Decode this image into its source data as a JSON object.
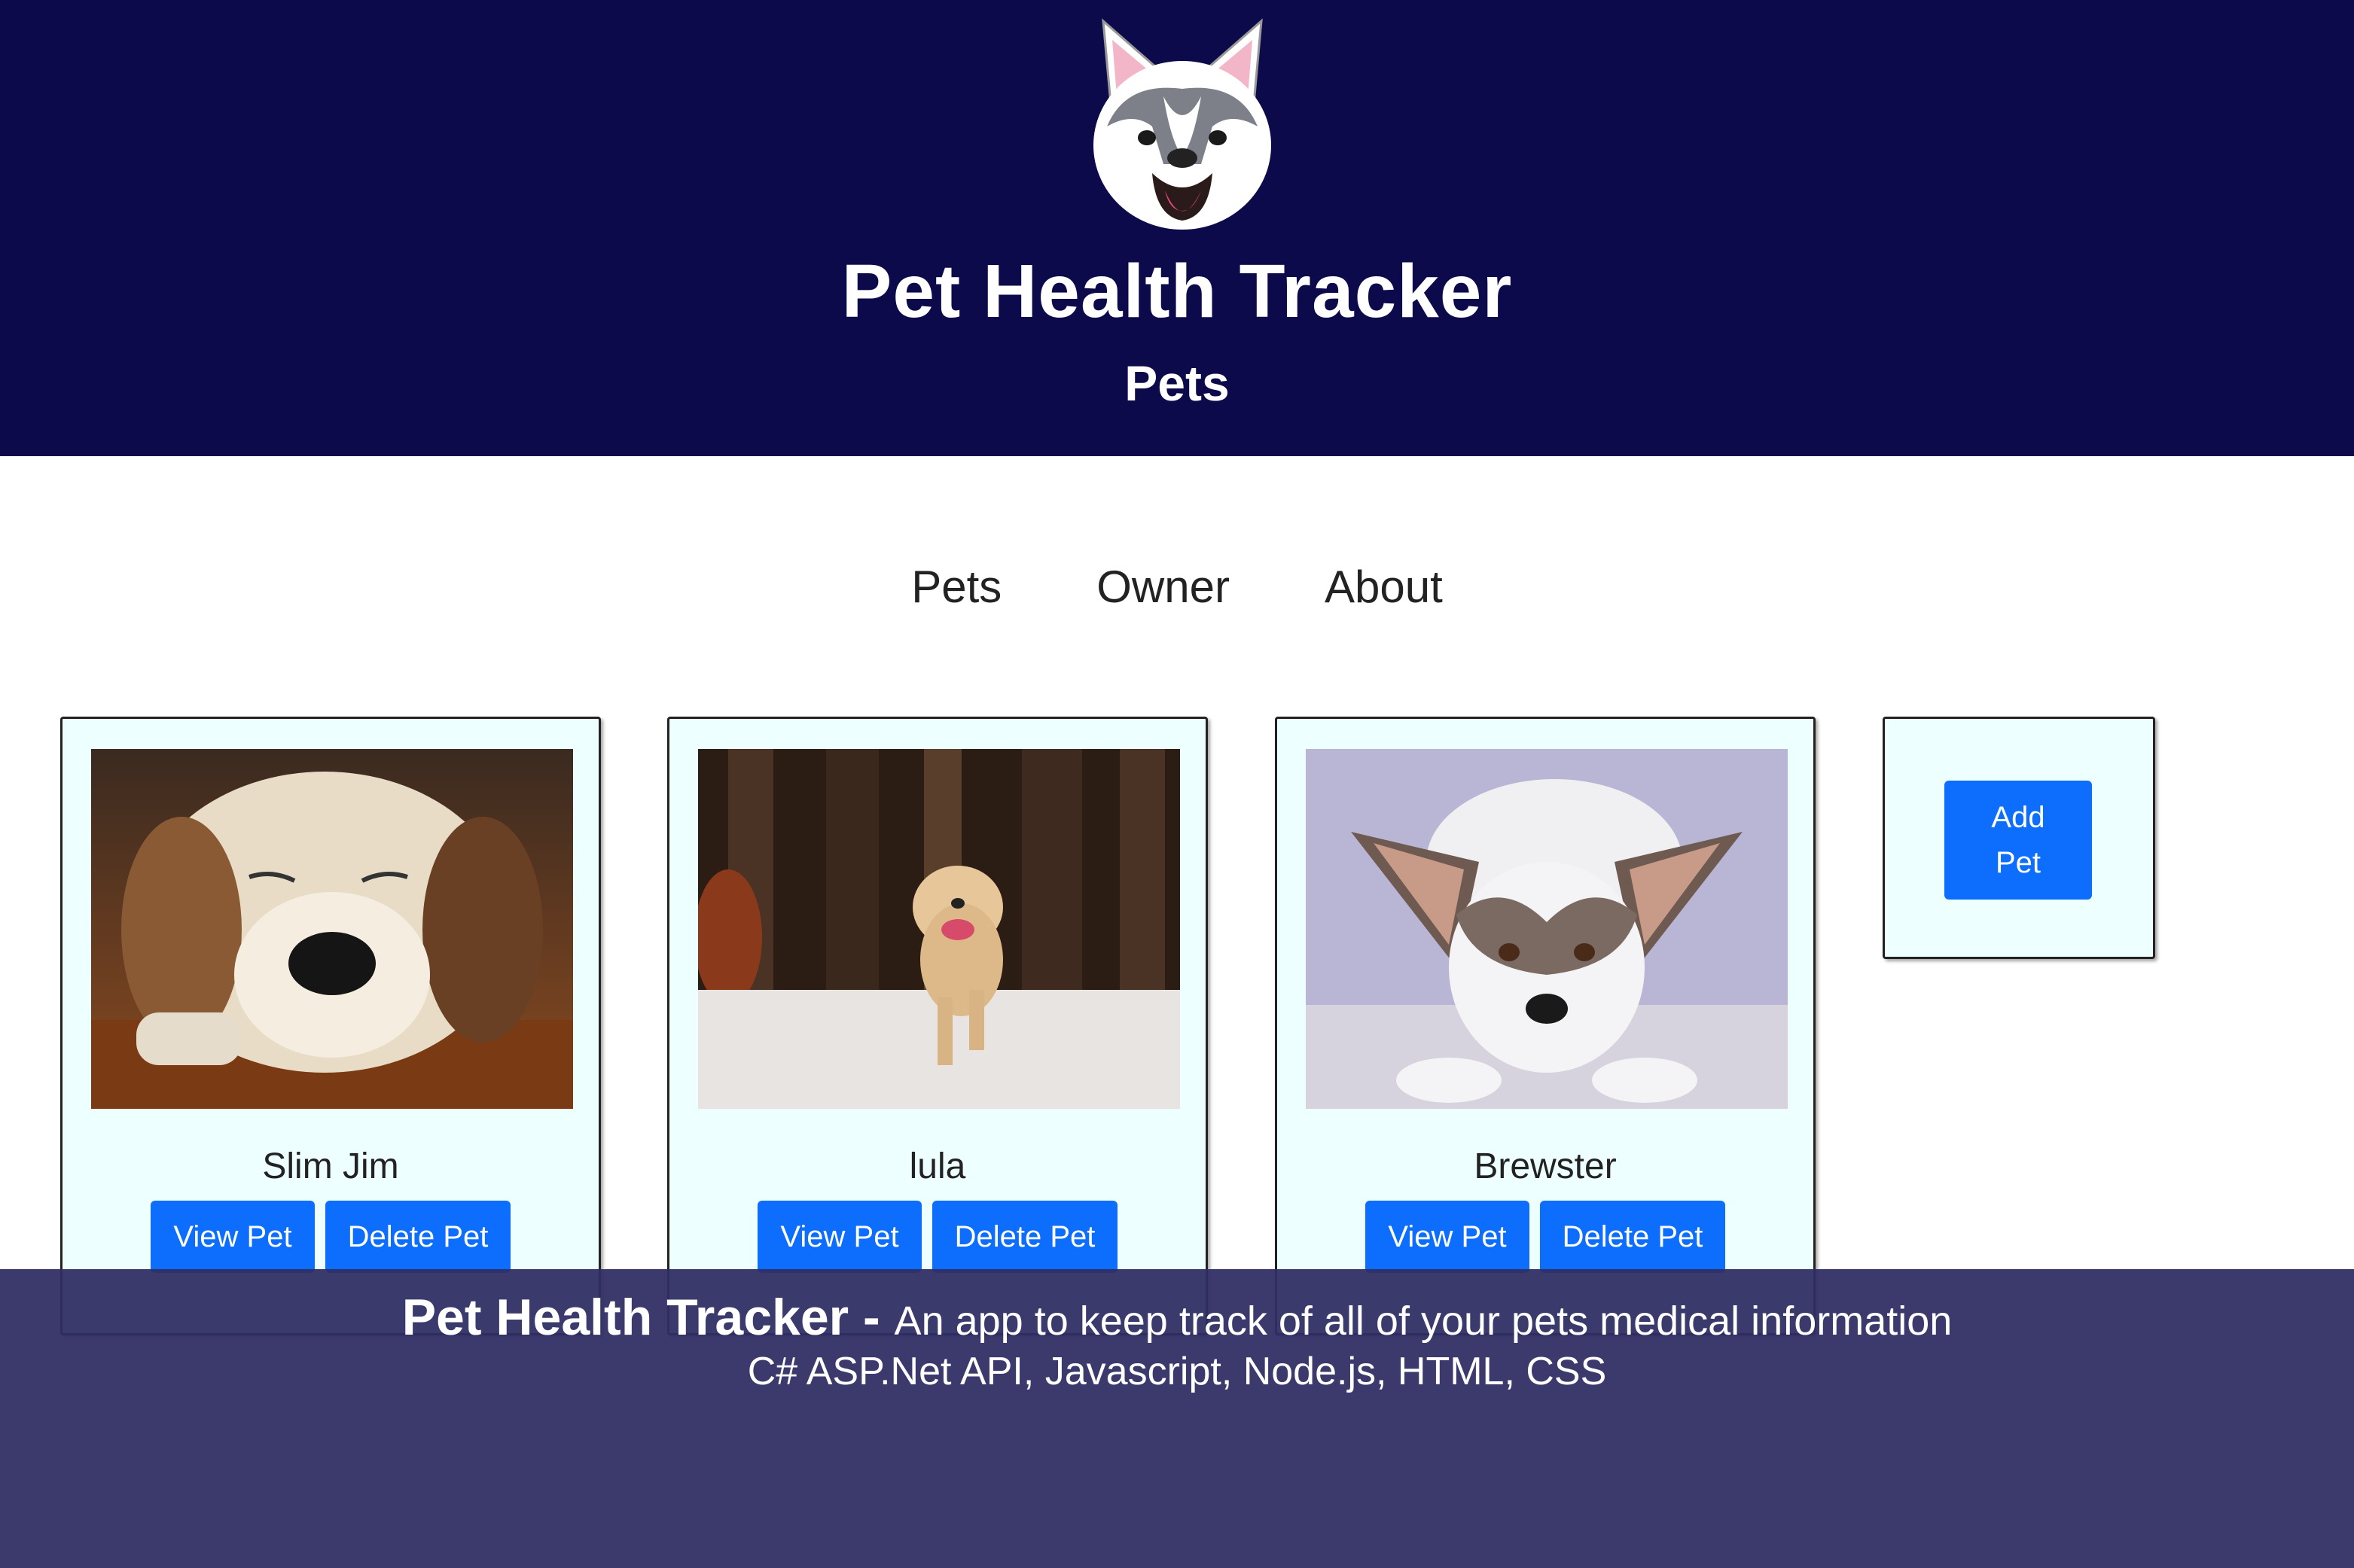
{
  "header": {
    "app_title": "Pet Health Tracker",
    "page_subtitle": "Pets",
    "bg_color": "#0c0a4b"
  },
  "nav": {
    "items": [
      {
        "label": "Pets"
      },
      {
        "label": "Owner"
      },
      {
        "label": "About"
      }
    ]
  },
  "pets": [
    {
      "name": "Slim Jim",
      "view_label": "View Pet",
      "delete_label": "Delete Pet"
    },
    {
      "name": "lula",
      "view_label": "View Pet",
      "delete_label": "Delete Pet"
    },
    {
      "name": "Brewster",
      "view_label": "View Pet",
      "delete_label": "Delete Pet"
    }
  ],
  "add_card": {
    "button_label": "Add Pet"
  },
  "caption": {
    "title": "Pet Health Tracker - ",
    "description": "An app to keep track of all of your pets medical information",
    "tech": "C# ASP.Net API, Javascript, Node.js, HTML, CSS"
  },
  "colors": {
    "button": "#0d6efd",
    "card_bg": "#eeffff",
    "caption_band": "#302e64"
  }
}
